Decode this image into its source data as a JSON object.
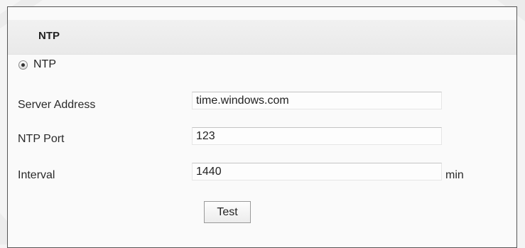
{
  "section": {
    "title": "NTP"
  },
  "ntp_option": {
    "label": "NTP",
    "selected": true
  },
  "form": {
    "server_address": {
      "label": "Server Address",
      "value": "time.windows.com"
    },
    "ntp_port": {
      "label": "NTP Port",
      "value": "123"
    },
    "interval": {
      "label": "Interval",
      "value": "1440",
      "unit": "min"
    },
    "test_button": "Test"
  },
  "icons": {
    "watermark": "camera-watermark-icon",
    "radio": "radio-selected-icon"
  },
  "colors": {
    "panel_border": "#555555",
    "header_bg": "#ececec",
    "watermark": "#dcdcdc"
  }
}
